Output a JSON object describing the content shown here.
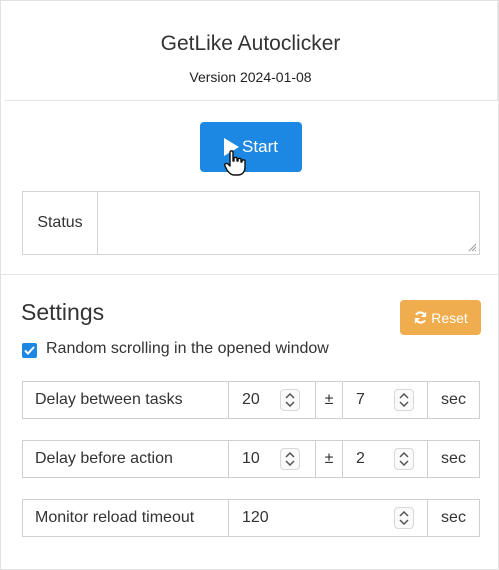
{
  "header": {
    "title": "GetLike Autoclicker",
    "version": "Version 2024-01-08"
  },
  "start_button": {
    "label": "Start"
  },
  "status": {
    "label": "Status",
    "value": ""
  },
  "settings": {
    "title": "Settings",
    "reset_label": "Reset",
    "random_scroll": {
      "label": "Random scrolling in the opened window",
      "checked": true
    },
    "rows": [
      {
        "label": "Delay between tasks",
        "value": "20",
        "pm": "±",
        "deviation": "7",
        "unit": "sec"
      },
      {
        "label": "Delay before action",
        "value": "10",
        "pm": "±",
        "deviation": "2",
        "unit": "sec"
      },
      {
        "label": "Monitor reload timeout",
        "value": "120",
        "unit": "sec"
      }
    ]
  },
  "colors": {
    "primary": "#1d87e4",
    "warning": "#f0ad4e"
  },
  "icons": [
    "play-icon",
    "hand-cursor-icon",
    "refresh-icon",
    "check-icon",
    "spinner-arrows-icon",
    "resize-grip-icon"
  ]
}
